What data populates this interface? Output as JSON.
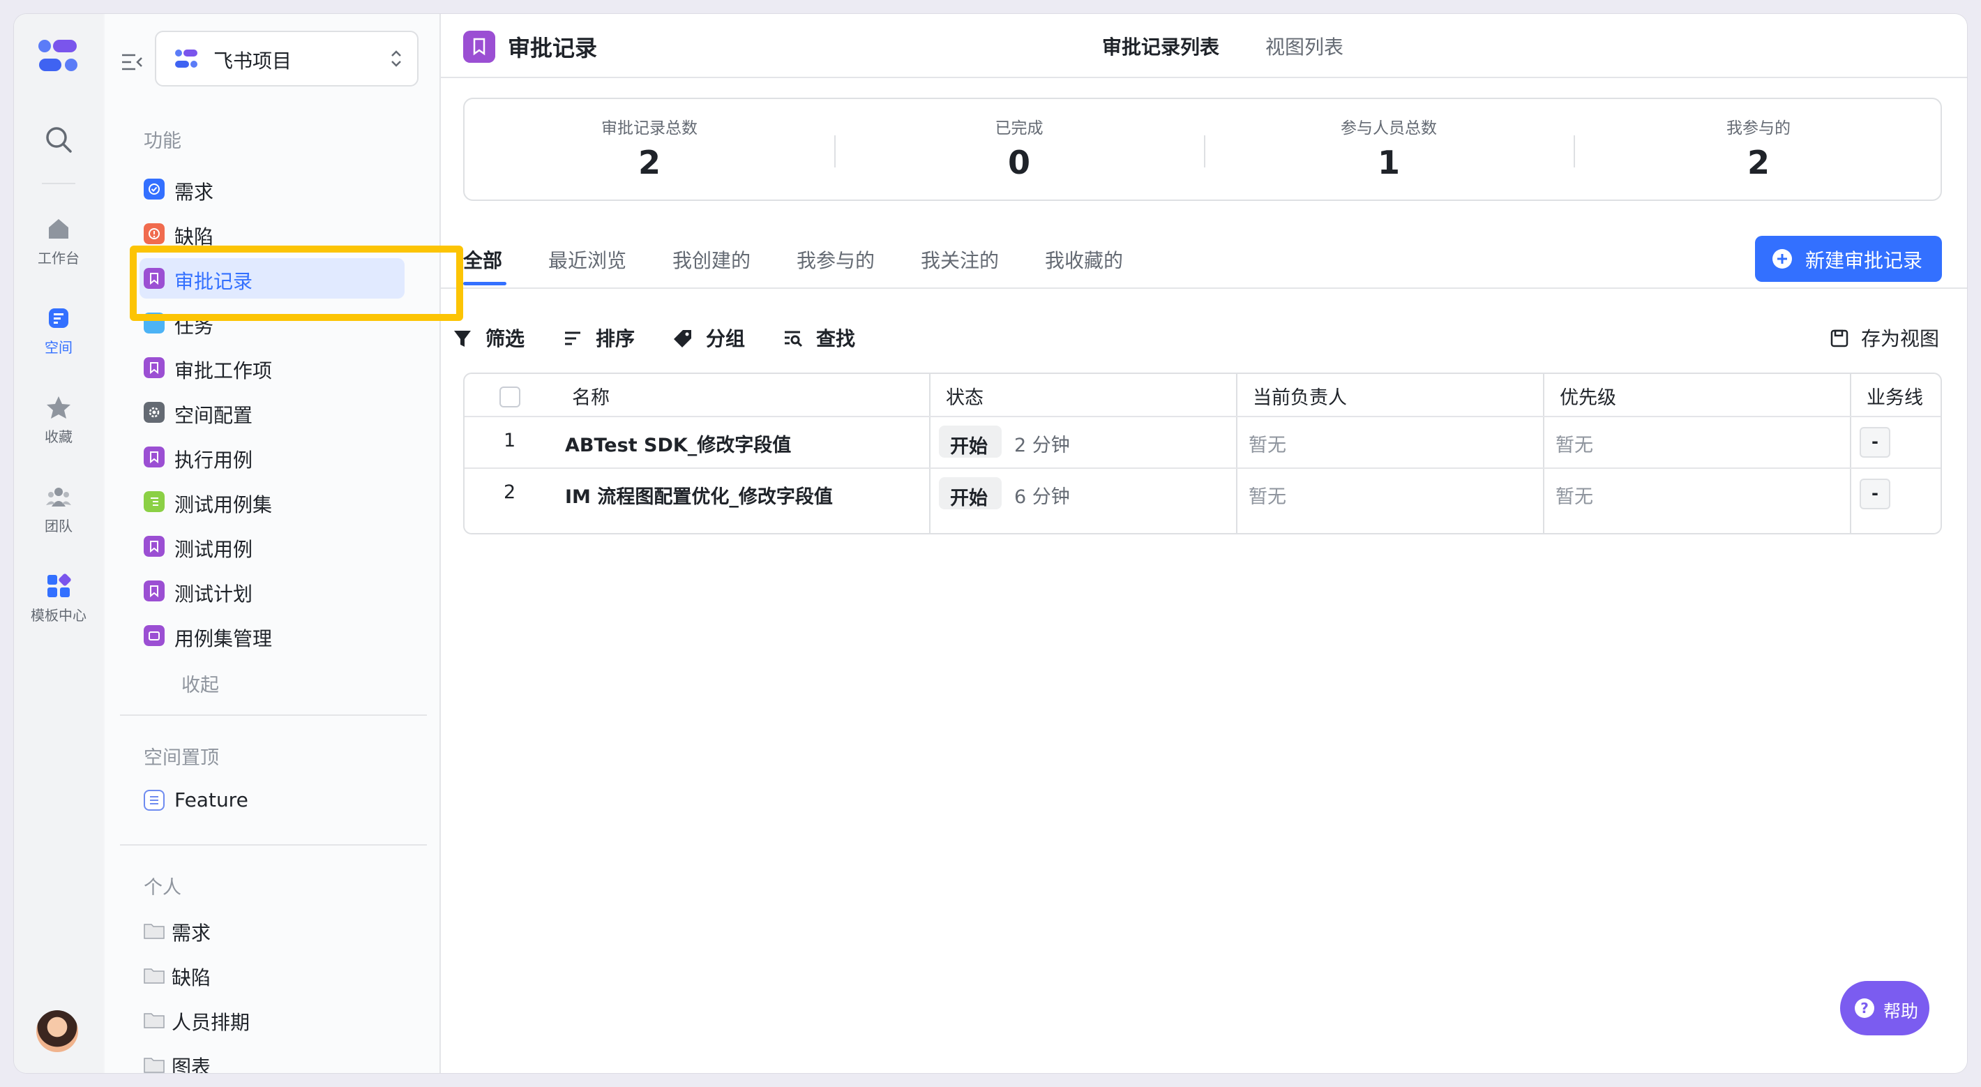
{
  "rail": {
    "items": [
      {
        "label": "工作台",
        "icon": "home-icon"
      },
      {
        "label": "空间",
        "icon": "space-icon"
      },
      {
        "label": "收藏",
        "icon": "star-icon"
      },
      {
        "label": "团队",
        "icon": "team-icon"
      },
      {
        "label": "模板中心",
        "icon": "template-icon"
      }
    ]
  },
  "sidebar": {
    "project": "飞书项目",
    "feature_title": "功能",
    "features": [
      {
        "label": "需求",
        "color": "#3370ff"
      },
      {
        "label": "缺陷",
        "color": "#f06b4e"
      },
      {
        "label": "审批记录",
        "color": "#9b4fd3"
      },
      {
        "label": "任务",
        "color": "#4cb3f5"
      },
      {
        "label": "审批工作项",
        "color": "#9b4fd3"
      },
      {
        "label": "空间配置",
        "color": "#646a73"
      },
      {
        "label": "执行用例",
        "color": "#9b4fd3"
      },
      {
        "label": "测试用例集",
        "color": "#8bd045"
      },
      {
        "label": "测试用例",
        "color": "#9b4fd3"
      },
      {
        "label": "测试计划",
        "color": "#9b4fd3"
      },
      {
        "label": "用例集管理",
        "color": "#9b4fd3"
      }
    ],
    "fold": "收起",
    "pinned_title": "空间置顶",
    "pinned": [
      {
        "label": "Feature"
      }
    ],
    "personal_title": "个人",
    "personal": [
      {
        "label": "需求"
      },
      {
        "label": "缺陷"
      },
      {
        "label": "人员排期"
      },
      {
        "label": "图表"
      }
    ]
  },
  "header": {
    "title": "审批记录",
    "tabs": [
      "审批记录列表",
      "视图列表"
    ]
  },
  "stats": [
    {
      "label": "审批记录总数",
      "value": "2"
    },
    {
      "label": "已完成",
      "value": "0"
    },
    {
      "label": "参与人员总数",
      "value": "1"
    },
    {
      "label": "我参与的",
      "value": "2"
    }
  ],
  "filter_tabs": [
    "全部",
    "最近浏览",
    "我创建的",
    "我参与的",
    "我关注的",
    "我收藏的"
  ],
  "new_button": "新建审批记录",
  "toolbar": {
    "filter": "筛选",
    "sort": "排序",
    "group": "分组",
    "find": "查找",
    "save_view": "存为视图"
  },
  "table": {
    "columns": [
      "名称",
      "状态",
      "当前负责人",
      "优先级",
      "业务线"
    ],
    "rows": [
      {
        "index": "1",
        "name": "ABTest SDK_修改字段值",
        "status": "开始",
        "time": "2 分钟",
        "owner": "暂无",
        "priority": "暂无",
        "line": "-"
      },
      {
        "index": "2",
        "name": "IM 流程图配置优化_修改字段值",
        "status": "开始",
        "time": "6 分钟",
        "owner": "暂无",
        "priority": "暂无",
        "line": "-"
      }
    ]
  },
  "help": "帮助",
  "colors": {
    "accent": "#3370ff",
    "highlight": "#fcc404",
    "help": "#7b5cf0"
  }
}
